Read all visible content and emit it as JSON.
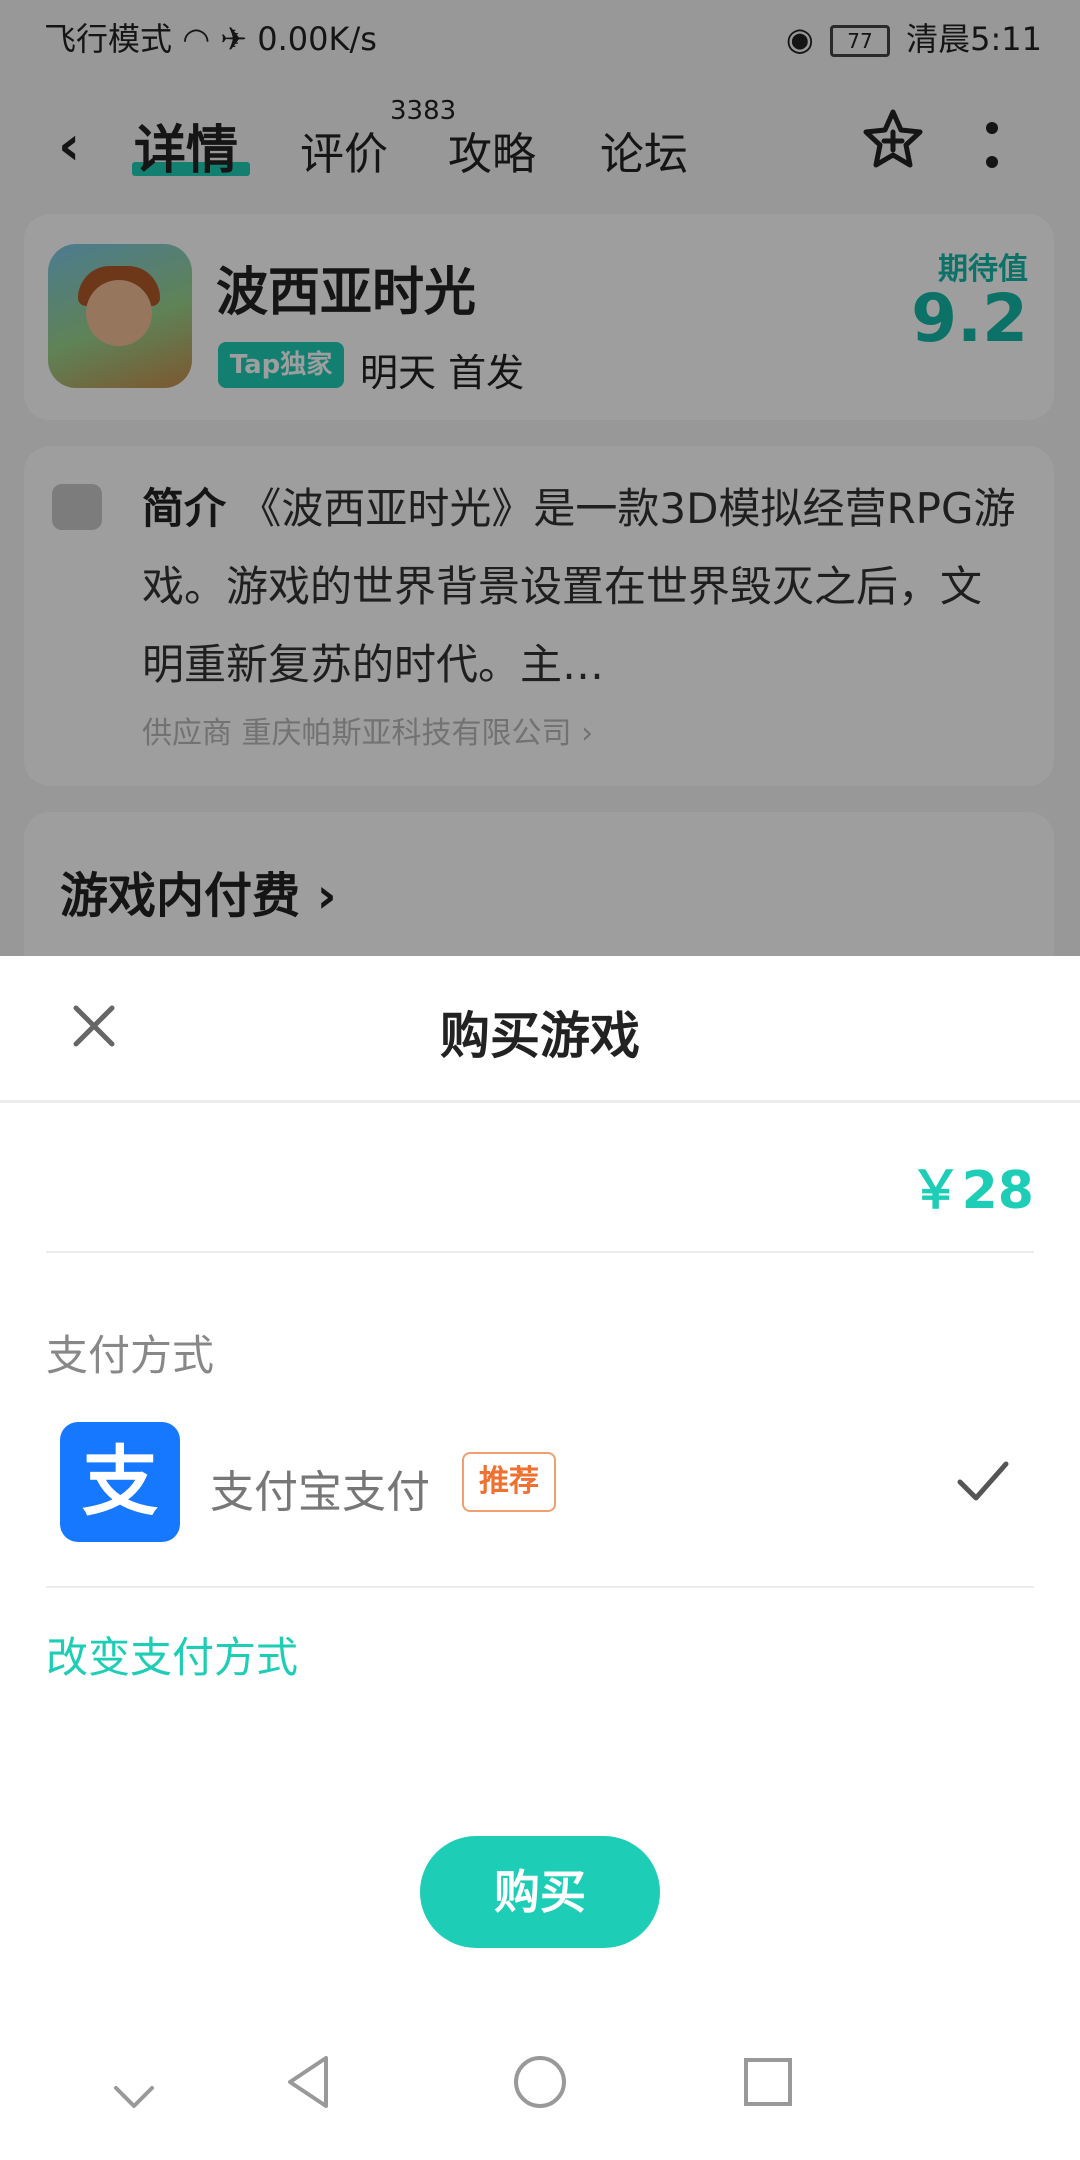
{
  "status_bar": {
    "left_text": "飞行模式",
    "speed": "0.00K/s",
    "battery": "77",
    "time": "清晨5:11"
  },
  "top_nav": {
    "tabs": [
      {
        "label": "详情",
        "active": true
      },
      {
        "label": "评价",
        "badge": "3383"
      },
      {
        "label": "攻略"
      },
      {
        "label": "论坛"
      }
    ],
    "icons": [
      "back-icon",
      "star-add-icon",
      "more-icon"
    ]
  },
  "game": {
    "title": "波西亚时光",
    "tag": "Tap独家",
    "release": "明天 首发",
    "expect_label": "期待值",
    "expect_value": "9.2"
  },
  "intro": {
    "label": "简介",
    "text": "《波西亚时光》是一款3D模拟经营RPG游戏。游戏的世界背景设置在世界毁灭之后，文明重新复苏的时代。主…",
    "supplier": "供应商 重庆帕斯亚科技有限公司 ›"
  },
  "in_game_pay": {
    "title": "游戏内付费 ›"
  },
  "purchase_sheet": {
    "title": "购买游戏",
    "price": "￥28",
    "payment_label": "支付方式",
    "method_icon_text": "支",
    "method_name": "支付宝支付",
    "method_tag": "推荐",
    "change_method": "改变支付方式",
    "buy_button": "购买"
  },
  "colors": {
    "accent": "#1ecdb6",
    "alipay_blue": "#1677ff",
    "recommend_orange": "#f07030"
  }
}
